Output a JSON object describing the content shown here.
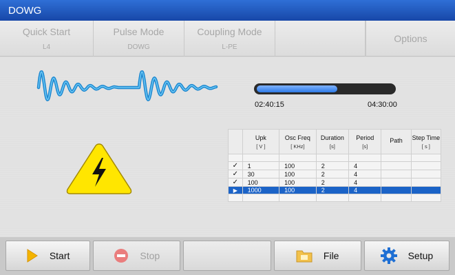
{
  "window": {
    "title": "DOWG"
  },
  "tabs": [
    {
      "label": "Quick Start",
      "value": "L4"
    },
    {
      "label": "Pulse Mode",
      "value": "DOWG"
    },
    {
      "label": "Coupling Mode",
      "value": "L-PE"
    }
  ],
  "options_label": "Options",
  "progress": {
    "elapsed": "02:40:15",
    "total": "04:30:00",
    "fraction": 0.59
  },
  "table": {
    "headers": [
      {
        "label": "Upk",
        "unit": "[ V ]"
      },
      {
        "label": "Osc Freq",
        "unit": "[ KHz]"
      },
      {
        "label": "Duration",
        "unit": "[s]"
      },
      {
        "label": "Period",
        "unit": "[s]"
      },
      {
        "label": "Path",
        "unit": ""
      },
      {
        "label": "Step Time",
        "unit": "[ s ]"
      }
    ],
    "rows": [
      {
        "status": "done",
        "cells": [
          "1",
          "100",
          "2",
          "4",
          "",
          ""
        ]
      },
      {
        "status": "done",
        "cells": [
          "30",
          "100",
          "2",
          "4",
          "",
          ""
        ]
      },
      {
        "status": "done",
        "cells": [
          "100",
          "100",
          "2",
          "4",
          "",
          ""
        ]
      },
      {
        "status": "current",
        "cells": [
          "1000",
          "100",
          "2",
          "4",
          "",
          ""
        ]
      }
    ]
  },
  "buttons": {
    "start": "Start",
    "stop": "Stop",
    "file": "File",
    "setup": "Setup"
  },
  "colors": {
    "title_bar": "#1e56bd",
    "accent_blue": "#1b63c7",
    "wave": "#2a9ee0",
    "warning_yellow": "#ffe600"
  },
  "icons": {
    "start": "play-triangle-icon",
    "stop": "stop-circle-icon",
    "file": "folder-icon",
    "setup": "gear-icon",
    "hazard": "high-voltage-warning-icon"
  }
}
